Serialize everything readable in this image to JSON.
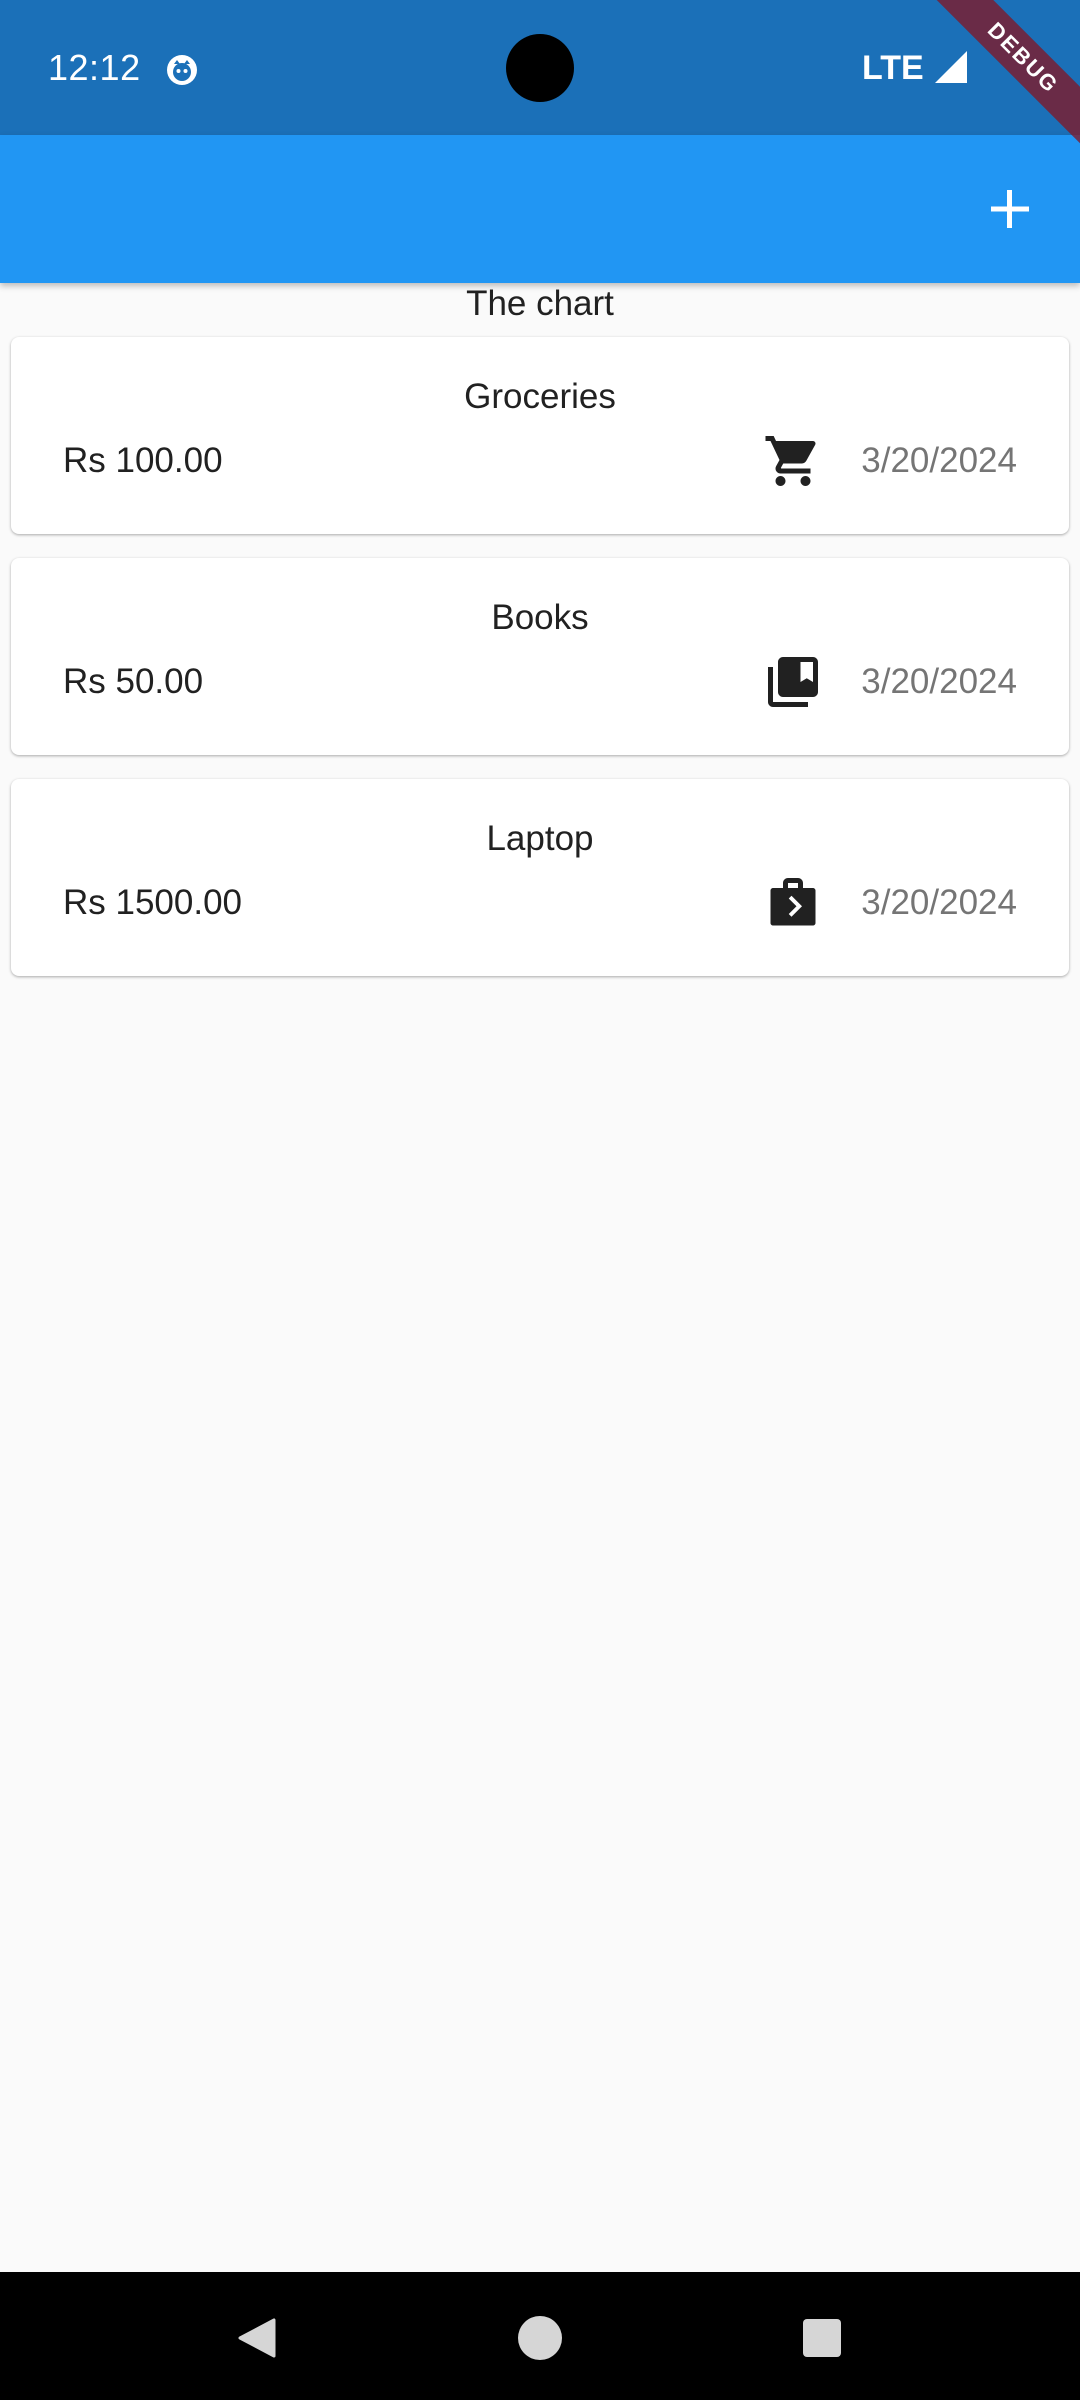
{
  "status_bar": {
    "time": "12:12",
    "network": "LTE",
    "debug_label": "DEBUG",
    "background_color": "#1b70b8"
  },
  "app_bar": {
    "background_color": "#2196f3",
    "action_icon": "add-icon"
  },
  "chart": {
    "label": "The chart"
  },
  "transactions": [
    {
      "title": "Groceries",
      "amount": "Rs 100.00",
      "date": "3/20/2024",
      "icon": "shopping-cart-icon"
    },
    {
      "title": "Books",
      "amount": "Rs 50.00",
      "date": "3/20/2024",
      "icon": "library-books-icon"
    },
    {
      "title": "Laptop",
      "amount": "Rs 1500.00",
      "date": "3/20/2024",
      "icon": "work-briefcase-icon"
    }
  ],
  "nav_bar": {
    "icons": [
      "back-icon",
      "home-icon",
      "recents-icon"
    ]
  }
}
